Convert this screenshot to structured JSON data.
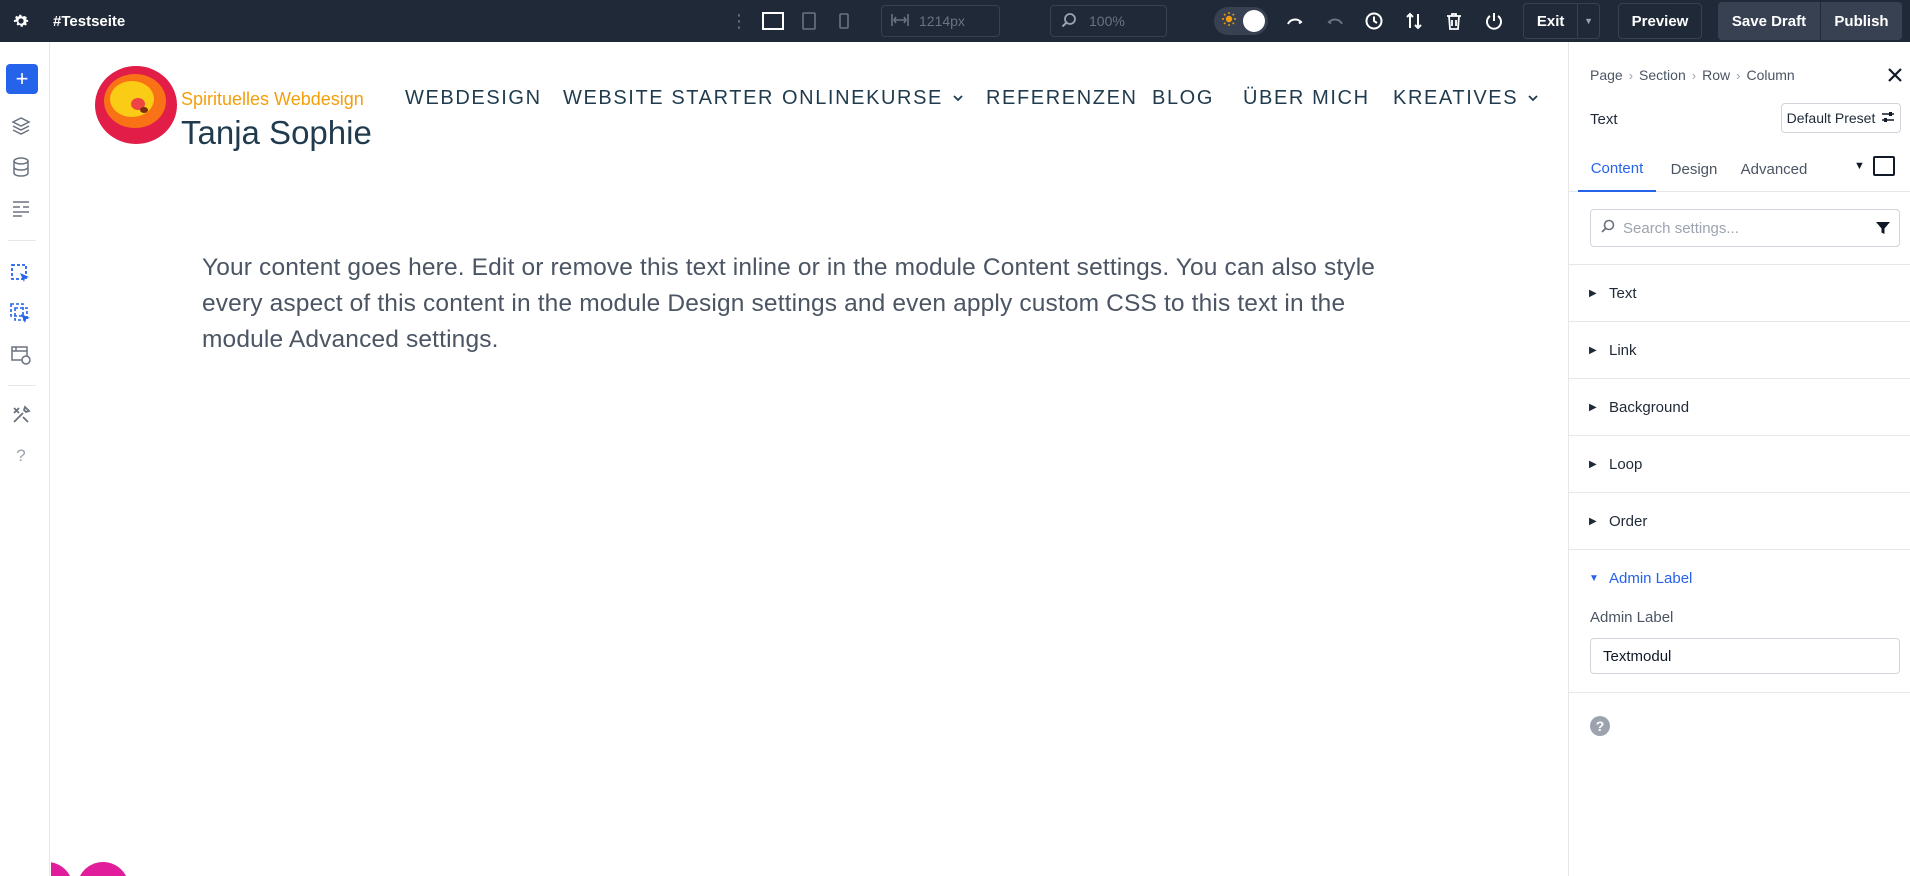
{
  "topbar": {
    "page_title": "#Testseite",
    "width_value": "1214px",
    "zoom_value": "100%",
    "exit_label": "Exit",
    "preview_label": "Preview",
    "save_draft_label": "Save Draft",
    "publish_label": "Publish"
  },
  "site": {
    "brand_tagline": "Spirituelles Webdesign",
    "brand_name": "Tanja Sophie",
    "nav": [
      {
        "label": "WEBDESIGN",
        "has_dropdown": false
      },
      {
        "label": "WEBSITE STARTER",
        "has_dropdown": false
      },
      {
        "label": "ONLINEKURSE",
        "has_dropdown": true
      },
      {
        "label": "REFERENZEN",
        "has_dropdown": false
      },
      {
        "label": "BLOG",
        "has_dropdown": false
      },
      {
        "label": "ÜBER MICH",
        "has_dropdown": false
      },
      {
        "label": "KREATIVES",
        "has_dropdown": true
      }
    ],
    "body_text": "Your content goes here. Edit or remove this text inline or in the module Content settings. You can also style every aspect of this content in the module Design settings and even apply custom CSS to this text in the module Advanced settings."
  },
  "panel": {
    "breadcrumb": [
      "Page",
      "Section",
      "Row",
      "Column"
    ],
    "module_title": "Text",
    "preset_label": "Default Preset",
    "tabs": [
      "Content",
      "Design",
      "Advanced"
    ],
    "active_tab": "Content",
    "search_placeholder": "Search settings...",
    "groups": [
      {
        "label": "Text",
        "open": false
      },
      {
        "label": "Link",
        "open": false
      },
      {
        "label": "Background",
        "open": false
      },
      {
        "label": "Loop",
        "open": false
      },
      {
        "label": "Order",
        "open": false
      },
      {
        "label": "Admin Label",
        "open": true
      }
    ],
    "admin_label_field_label": "Admin Label",
    "admin_label_value": "Textmodul",
    "help_glyph": "?"
  },
  "colors": {
    "topbar_bg": "#1f2937",
    "accent_blue": "#2563eb",
    "brand_orange": "#f59e0b",
    "brand_navy": "#1f3b4d",
    "blob_magenta": "#e11d9b"
  },
  "icons": [
    "gear-icon",
    "kebab-icon",
    "desktop-icon",
    "tablet-icon",
    "phone-icon",
    "width-icon",
    "zoom-icon",
    "sun-icon",
    "undo-icon",
    "redo-icon",
    "history-icon",
    "sort-icon",
    "trash-icon",
    "power-icon",
    "plus-icon",
    "layers-icon",
    "database-icon",
    "layout-icon",
    "pointer-module-icon",
    "pointer-modules-icon",
    "portability-icon",
    "tools-icon",
    "help-icon",
    "close-icon",
    "preset-icon",
    "filter-icon",
    "search-icon"
  ]
}
